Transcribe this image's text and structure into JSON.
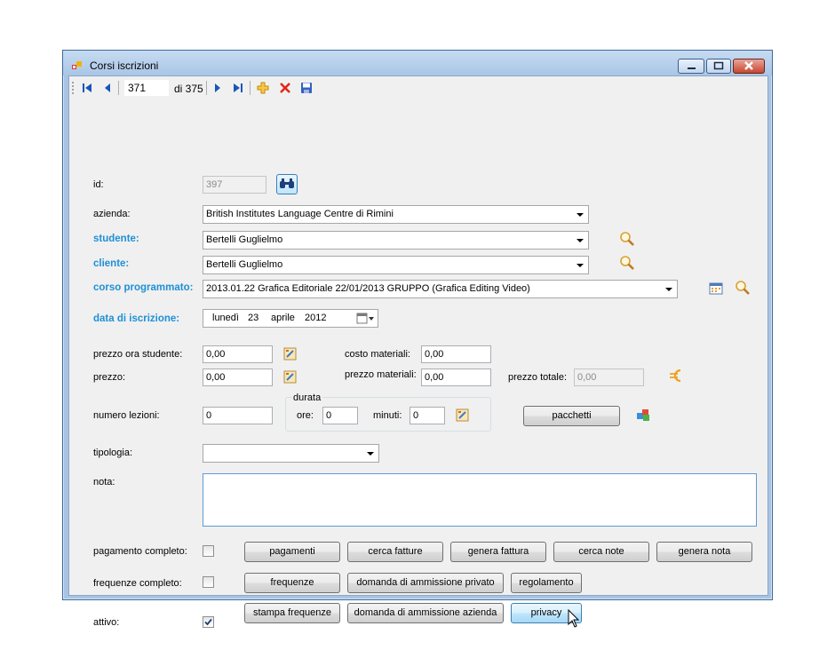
{
  "window": {
    "title": "Corsi iscrizioni"
  },
  "navigator": {
    "position": "371",
    "count_label": "di 375"
  },
  "form": {
    "id": {
      "label": "id:",
      "value": "397"
    },
    "azienda": {
      "label": "azienda:",
      "value": "British Institutes Language Centre di Rimini"
    },
    "studente": {
      "label": "studente:",
      "value": "Bertelli Guglielmo"
    },
    "cliente": {
      "label": "cliente:",
      "value": "Bertelli Guglielmo"
    },
    "corso_programmato": {
      "label": "corso programmato:",
      "value": "2013.01.22 Grafica Editoriale 22/01/2013 GRUPPO (Grafica Editing Video)"
    },
    "data_iscrizione": {
      "label": "data di iscrizione:",
      "weekday": "lunedì",
      "day": "23",
      "month": "aprile",
      "year": "2012"
    },
    "prezzo_ora_studente": {
      "label": "prezzo ora studente:",
      "value": "0,00"
    },
    "costo_materiali": {
      "label": "costo materiali:",
      "value": "0,00"
    },
    "prezzo": {
      "label": "prezzo:",
      "value": "0,00"
    },
    "prezzo_materiali": {
      "label": "prezzo materiali:",
      "value": "0,00"
    },
    "prezzo_totale": {
      "label": "prezzo totale:",
      "value": "0,00"
    },
    "numero_lezioni": {
      "label": "numero lezioni:",
      "value": "0"
    },
    "durata": {
      "label": "durata",
      "ore_label": "ore:",
      "ore_value": "0",
      "minuti_label": "minuti:",
      "minuti_value": "0"
    },
    "tipologia": {
      "label": "tipologia:",
      "value": ""
    },
    "nota": {
      "label": "nota:",
      "value": ""
    },
    "pagamento_completo": {
      "label": "pagamento completo:",
      "checked": false
    },
    "frequenze_completo": {
      "label": "frequenze completo:",
      "checked": false
    },
    "attivo": {
      "label": "attivo:",
      "checked": true
    }
  },
  "buttons": {
    "pacchetti": "pacchetti",
    "pagamenti": "pagamenti",
    "cerca_fatture": "cerca fatture",
    "genera_fattura": "genera fattura",
    "cerca_note": "cerca note",
    "genera_nota": "genera nota",
    "frequenze": "frequenze",
    "domanda_privato": "domanda di ammissione privato",
    "regolamento": "regolamento",
    "stampa_frequenze": "stampa frequenze",
    "domanda_azienda": "domanda di ammissione azienda",
    "privacy": "privacy"
  },
  "colors": {
    "highlight_label": "#1e90d6",
    "close_button": "#c9452f",
    "euro_icon": "#f0a020"
  }
}
